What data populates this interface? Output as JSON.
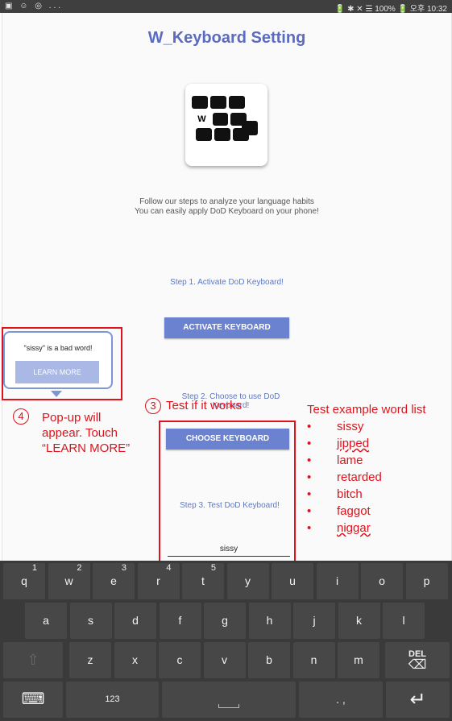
{
  "status": {
    "left": "▣ ☺ ◎ ...",
    "right": "🔋 ✱ ✕ ☰ 100% 🔋 오후 10:32"
  },
  "app": {
    "title": "W_Keyboard Setting",
    "logo_key": "W",
    "intro_line1": "Follow our steps to analyze your language habits",
    "intro_line2": "You can easily apply DoD Keyboard on your phone!",
    "step1": "Step 1. Activate DoD Keyboard!",
    "activate_button": "ACTIVATE KEYBOARD",
    "step2": "Step 2. Choose to use DoD Keyboard!",
    "choose_button": "CHOOSE KEYBOARD",
    "step3": "Step 3. Test DoD Keyboard!",
    "test_input_value": "sissy"
  },
  "popup": {
    "message": "\"sissy\" is a bad word!",
    "learn_more": "LEARN MORE"
  },
  "annotations": {
    "num3": "3",
    "test_text": "Test if it works",
    "num4": "4",
    "popup_line1": "Pop-up will",
    "popup_line2": "appear. Touch",
    "popup_line3": "“LEARN MORE”",
    "word_list_title": "Test example word list",
    "words": [
      "sissy",
      "jipped",
      "lame",
      "retarded",
      "bitch",
      "faggot",
      "niggar"
    ],
    "bullet": "•"
  },
  "keyboard": {
    "row1": [
      {
        "k": "q",
        "n": "1"
      },
      {
        "k": "w",
        "n": "2"
      },
      {
        "k": "e",
        "n": "3"
      },
      {
        "k": "r",
        "n": "4"
      },
      {
        "k": "t",
        "n": "5"
      },
      {
        "k": "y",
        "n": ""
      },
      {
        "k": "u",
        "n": ""
      },
      {
        "k": "i",
        "n": ""
      },
      {
        "k": "o",
        "n": ""
      },
      {
        "k": "p",
        "n": ""
      }
    ],
    "row2": [
      "a",
      "s",
      "d",
      "f",
      "g",
      "h",
      "j",
      "k",
      "l"
    ],
    "row3": [
      "z",
      "x",
      "c",
      "v",
      "b",
      "n",
      "m"
    ],
    "shift": "⇧",
    "del": "DEL",
    "del_symbol": "⌫",
    "keyboard_icon": "⌨",
    "num_key": "123",
    "space": "",
    "punct": ". ,",
    "enter": "↵"
  },
  "colors": {
    "accent": "#5b6bbf",
    "button": "#6b82d1",
    "annotation": "#e1121b",
    "keyboard_bg": "#3a3a3a"
  }
}
